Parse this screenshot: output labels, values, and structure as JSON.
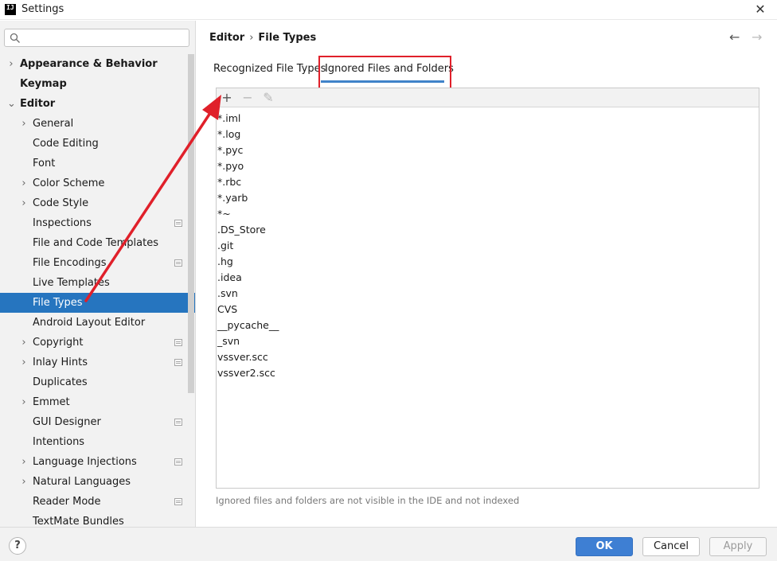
{
  "window": {
    "app_icon_text": "IJ",
    "title": "Settings"
  },
  "search": {
    "placeholder": "",
    "value": ""
  },
  "sidebar": {
    "items": [
      {
        "label": "Appearance & Behavior",
        "level": 0,
        "arrow": "›",
        "selected": false,
        "project_icon": false
      },
      {
        "label": "Keymap",
        "level": 0,
        "arrow": "",
        "selected": false,
        "project_icon": false
      },
      {
        "label": "Editor",
        "level": 0,
        "arrow": "⌄",
        "selected": false,
        "project_icon": false
      },
      {
        "label": "General",
        "level": 1,
        "arrow": "›",
        "selected": false,
        "project_icon": false
      },
      {
        "label": "Code Editing",
        "level": 1,
        "arrow": "",
        "selected": false,
        "project_icon": false
      },
      {
        "label": "Font",
        "level": 1,
        "arrow": "",
        "selected": false,
        "project_icon": false
      },
      {
        "label": "Color Scheme",
        "level": 1,
        "arrow": "›",
        "selected": false,
        "project_icon": false
      },
      {
        "label": "Code Style",
        "level": 1,
        "arrow": "›",
        "selected": false,
        "project_icon": false
      },
      {
        "label": "Inspections",
        "level": 1,
        "arrow": "",
        "selected": false,
        "project_icon": true
      },
      {
        "label": "File and Code Templates",
        "level": 1,
        "arrow": "",
        "selected": false,
        "project_icon": false
      },
      {
        "label": "File Encodings",
        "level": 1,
        "arrow": "",
        "selected": false,
        "project_icon": true
      },
      {
        "label": "Live Templates",
        "level": 1,
        "arrow": "",
        "selected": false,
        "project_icon": false
      },
      {
        "label": "File Types",
        "level": 1,
        "arrow": "",
        "selected": true,
        "project_icon": false
      },
      {
        "label": "Android Layout Editor",
        "level": 1,
        "arrow": "",
        "selected": false,
        "project_icon": false
      },
      {
        "label": "Copyright",
        "level": 1,
        "arrow": "›",
        "selected": false,
        "project_icon": true
      },
      {
        "label": "Inlay Hints",
        "level": 1,
        "arrow": "›",
        "selected": false,
        "project_icon": true
      },
      {
        "label": "Duplicates",
        "level": 1,
        "arrow": "",
        "selected": false,
        "project_icon": false
      },
      {
        "label": "Emmet",
        "level": 1,
        "arrow": "›",
        "selected": false,
        "project_icon": false
      },
      {
        "label": "GUI Designer",
        "level": 1,
        "arrow": "",
        "selected": false,
        "project_icon": true
      },
      {
        "label": "Intentions",
        "level": 1,
        "arrow": "",
        "selected": false,
        "project_icon": false
      },
      {
        "label": "Language Injections",
        "level": 1,
        "arrow": "›",
        "selected": false,
        "project_icon": true
      },
      {
        "label": "Natural Languages",
        "level": 1,
        "arrow": "›",
        "selected": false,
        "project_icon": false
      },
      {
        "label": "Reader Mode",
        "level": 1,
        "arrow": "",
        "selected": false,
        "project_icon": true
      },
      {
        "label": "TextMate Bundles",
        "level": 1,
        "arrow": "",
        "selected": false,
        "project_icon": false
      }
    ]
  },
  "breadcrumb": {
    "parent": "Editor",
    "separator": "›",
    "current": "File Types"
  },
  "nav": {
    "back": "←",
    "forward": "→"
  },
  "tabs": {
    "recognized": "Recognized File Types",
    "ignored": "Ignored Files and Folders",
    "active": "ignored"
  },
  "toolbar": {
    "add": "+",
    "remove": "−",
    "edit": "✎"
  },
  "ignored_list": [
    "*.iml",
    "*.log",
    "*.pyc",
    "*.pyo",
    "*.rbc",
    "*.yarb",
    "*~",
    ".DS_Store",
    ".git",
    ".hg",
    ".idea",
    ".svn",
    "CVS",
    "__pycache__",
    "_svn",
    "vssver.scc",
    "vssver2.scc"
  ],
  "hint": "Ignored files and folders are not visible in the IDE and not indexed",
  "footer": {
    "help": "?",
    "ok": "OK",
    "cancel": "Cancel",
    "apply": "Apply"
  },
  "colors": {
    "selection": "#2675bf",
    "ok_button": "#3e7fd3",
    "annotation_red": "#e0202a",
    "tab_underline": "#4083c9"
  }
}
